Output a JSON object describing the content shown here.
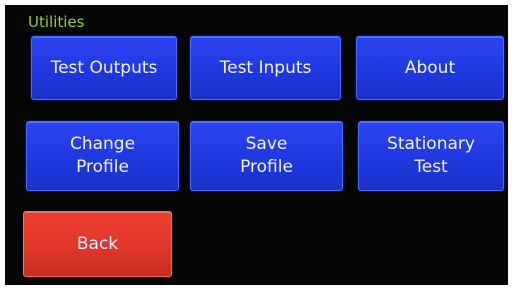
{
  "header": {
    "title": "Utilities"
  },
  "buttons": {
    "test_outputs": "Test Outputs",
    "test_inputs": "Test Inputs",
    "about": "About",
    "change_profile": "Change\nProfile",
    "save_profile": "Save\nProfile",
    "stationary_test": "Stationary\nTest",
    "back": "Back"
  },
  "colors": {
    "title": "#8fd12a",
    "button_blue": "#2340e8",
    "button_red": "#e23a2e",
    "background": "#050506"
  }
}
